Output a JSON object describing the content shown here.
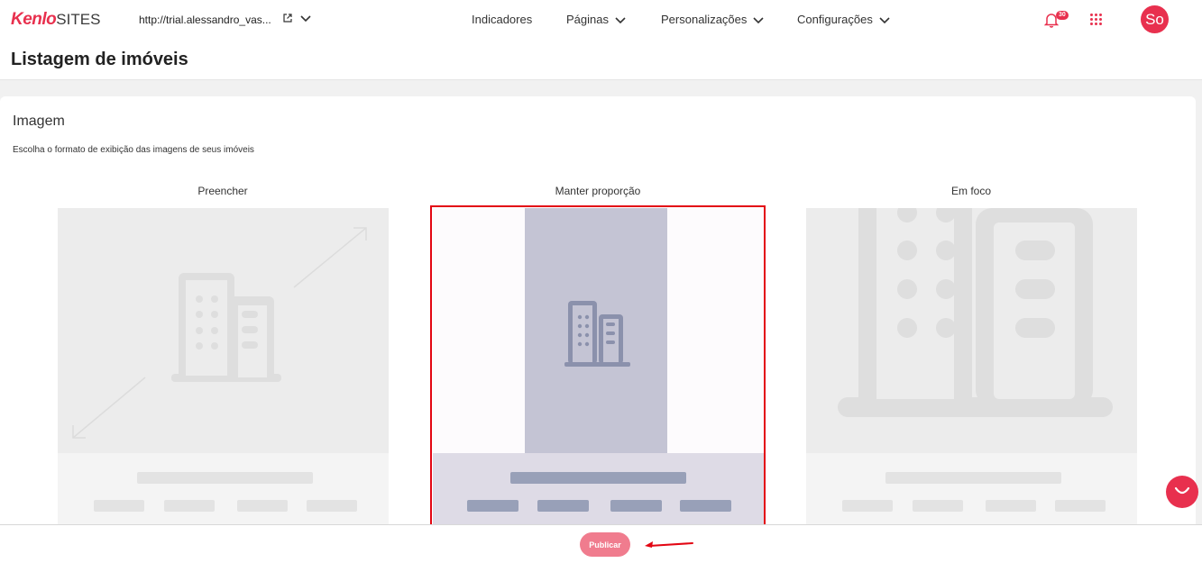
{
  "app": {
    "logo_brand": "Kenlo",
    "logo_product": "SITES",
    "site_url": "http://trial.alessandro_vas..."
  },
  "nav": {
    "items": [
      {
        "label": "Indicadores"
      },
      {
        "label": "Páginas"
      },
      {
        "label": "Personalizações"
      },
      {
        "label": "Configurações"
      }
    ],
    "notifications_count": "30",
    "avatar_initials": "So"
  },
  "page": {
    "title": "Listagem de imóveis"
  },
  "image_section": {
    "title": "Imagem",
    "description": "Escolha o formato de exibição das imagens de seus imóveis",
    "options": [
      {
        "label": "Preencher",
        "selected": false
      },
      {
        "label": "Manter proporção",
        "selected": true
      },
      {
        "label": "Em foco",
        "selected": false
      }
    ]
  },
  "footer": {
    "publish_label": "Publicar"
  },
  "colors": {
    "brand": "#e8304e",
    "selection_border": "#e30613"
  }
}
